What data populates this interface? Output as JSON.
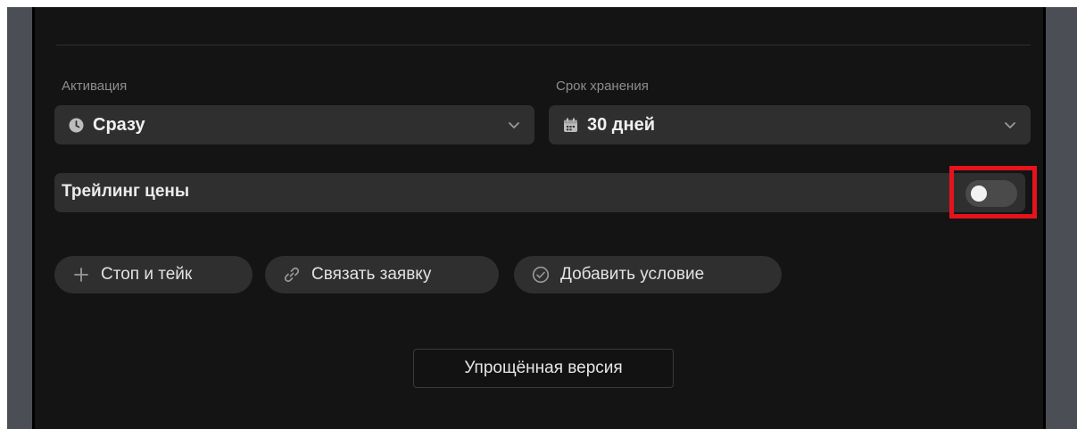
{
  "activation": {
    "label": "Активация",
    "value": "Сразу",
    "icon": "clock-icon"
  },
  "storage": {
    "label": "Срок хранения",
    "value": "30 дней",
    "icon": "calendar-icon"
  },
  "trailing": {
    "label": "Трейлинг цены",
    "enabled": false
  },
  "chips": [
    {
      "label": "Стоп и тейк",
      "icon": "plus-icon"
    },
    {
      "label": "Связать заявку",
      "icon": "link-icon"
    },
    {
      "label": "Добавить условие",
      "icon": "check-circle-icon"
    }
  ],
  "footer": {
    "simple_label": "Упрощённая версия"
  },
  "colors": {
    "panel_bg": "#141414",
    "control_bg": "#2f2f2f",
    "highlight": "#e5131c",
    "side_bar": "#4b4f55"
  }
}
